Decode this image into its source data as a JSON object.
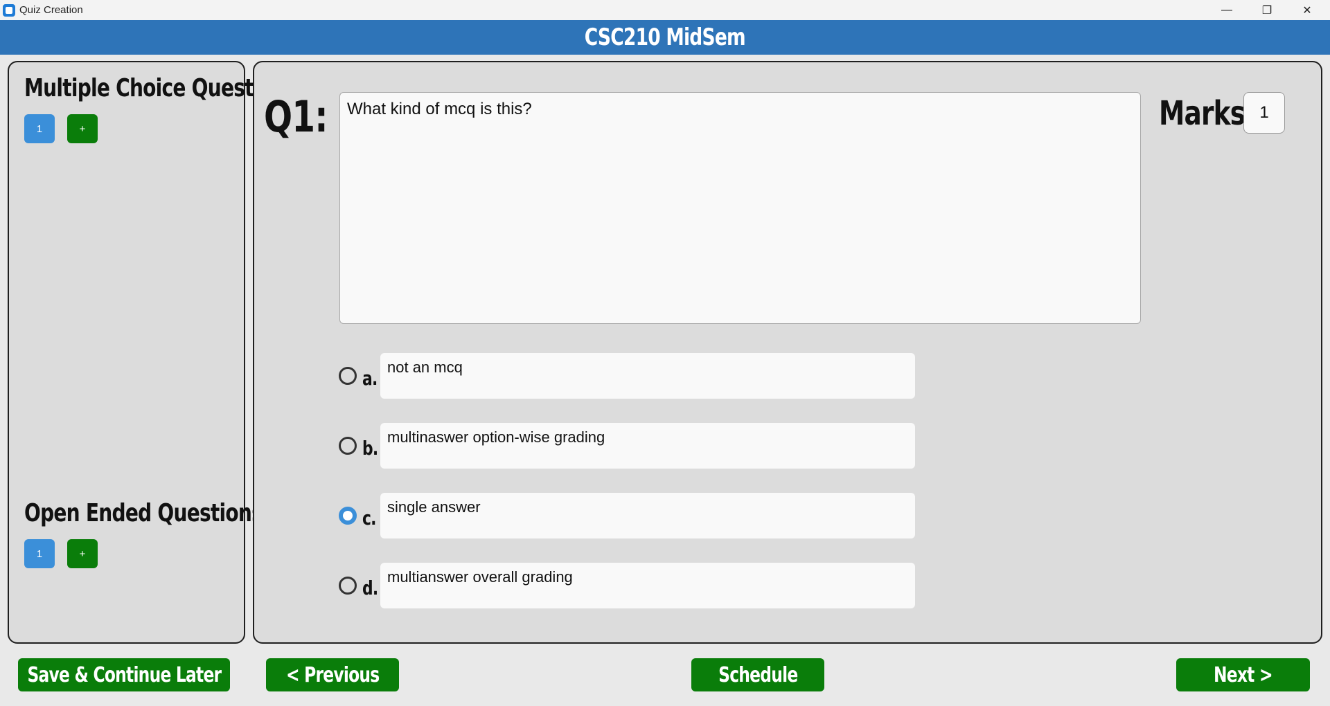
{
  "window": {
    "title": "Quiz Creation",
    "controls": {
      "minimize": "—",
      "maximize": "❐",
      "close": "✕"
    }
  },
  "header": {
    "title": "CSC210 MidSem"
  },
  "sidebar": {
    "mcq": {
      "title": "Multiple Choice Questions",
      "questions": [
        "1"
      ],
      "add_label": "+"
    },
    "open_ended": {
      "title": "Open Ended Questions",
      "questions": [
        "1"
      ],
      "add_label": "+"
    }
  },
  "question": {
    "label": "Q1:",
    "text": "What kind of mcq is this?",
    "marks_label": "Marks:",
    "marks_value": "1",
    "options": [
      {
        "letter": "a.",
        "text": "not an mcq",
        "selected": false
      },
      {
        "letter": "b.",
        "text": "multinaswer option-wise grading",
        "selected": false
      },
      {
        "letter": "c.",
        "text": "single answer",
        "selected": true
      },
      {
        "letter": "d.",
        "text": "multianswer overall grading",
        "selected": false
      }
    ]
  },
  "footer": {
    "save_label": "Save & Continue Later",
    "previous_label": "< Previous",
    "schedule_label": "Schedule",
    "next_label": "Next >"
  },
  "colors": {
    "header_bg": "#2e74b8",
    "button_green": "#0a7d0a",
    "button_blue": "#3b8fd9",
    "panel_bg": "#dcdcdc"
  }
}
